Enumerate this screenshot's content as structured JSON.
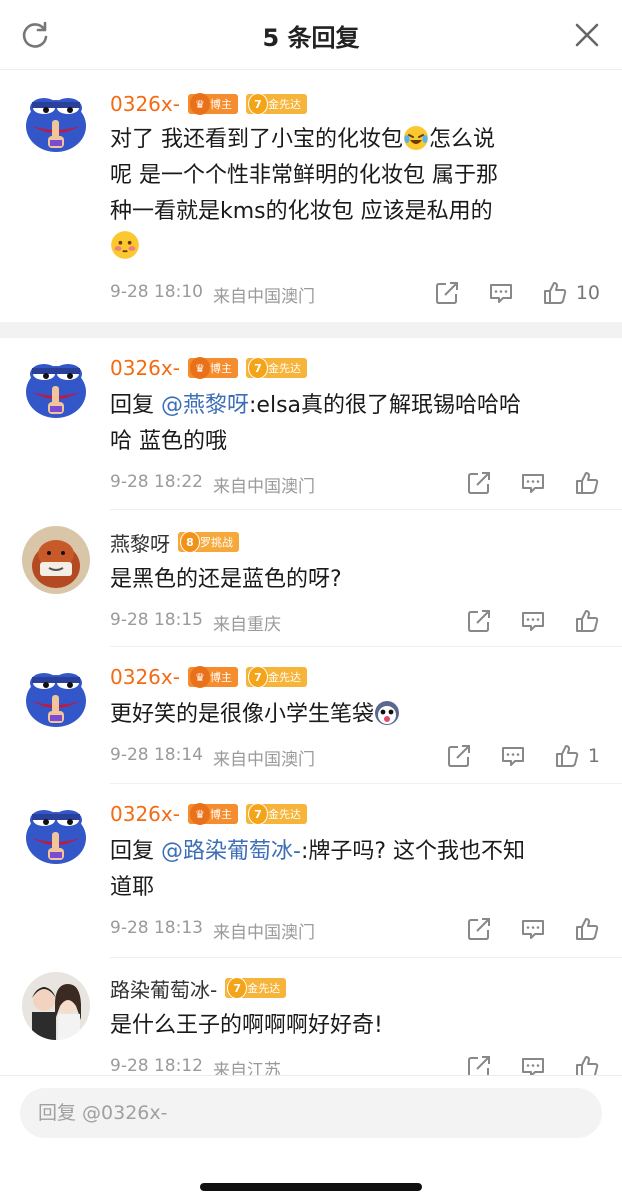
{
  "header": {
    "title": "5 条回复"
  },
  "main_comment": {
    "name": "0326x-",
    "badges": [
      "博主",
      "金先达"
    ],
    "text_lines": [
      "对了 我还看到了小宝的化妆包",
      "怎么说",
      "呢 是一个个性非常鲜明的化妆包 属于那",
      "种一看就是kms的化妆包 应该是私用的"
    ],
    "time": "9-28 18:10",
    "source": "来自中国澳门",
    "likes": "10"
  },
  "replies": [
    {
      "name": "0326x-",
      "badges": [
        "博主",
        "金先达"
      ],
      "prefix": "回复 ",
      "mention": "@燕黎呀",
      "line1_rest": ":elsa真的很了解珉锡哈哈哈",
      "line2": "哈 蓝色的哦",
      "time": "9-28 18:22",
      "source": "来自中国澳门"
    },
    {
      "name": "燕黎呀",
      "badges": [
        "罗挑战"
      ],
      "level": "8",
      "text": "是黑色的还是蓝色的呀?",
      "time": "9-28 18:15",
      "source": "来自重庆"
    },
    {
      "name": "0326x-",
      "badges": [
        "博主",
        "金先达"
      ],
      "text": "更好笑的是很像小学生笔袋",
      "time": "9-28 18:14",
      "source": "来自中国澳门",
      "likes": "1"
    },
    {
      "name": "0326x-",
      "badges": [
        "博主",
        "金先达"
      ],
      "prefix": "回复 ",
      "mention": "@路染葡萄冰-",
      "line1_rest": ":牌子吗? 这个我也不知",
      "line2": "道耶",
      "time": "9-28 18:13",
      "source": "来自中国澳门"
    },
    {
      "name": "路染葡萄冰-",
      "badges": [
        "金先达"
      ],
      "text": "是什么王子的啊啊啊好好奇!",
      "time": "9-28 18:12",
      "source": "来自江苏"
    }
  ],
  "level_badge": "7",
  "footer": {
    "placeholder": "回复 @0326x-"
  },
  "colors": {
    "name_orange": "#f36b12",
    "mention_blue": "#3c6fb6",
    "badge_orange": "#f58c2e",
    "badge_gold": "#f7b43a"
  }
}
